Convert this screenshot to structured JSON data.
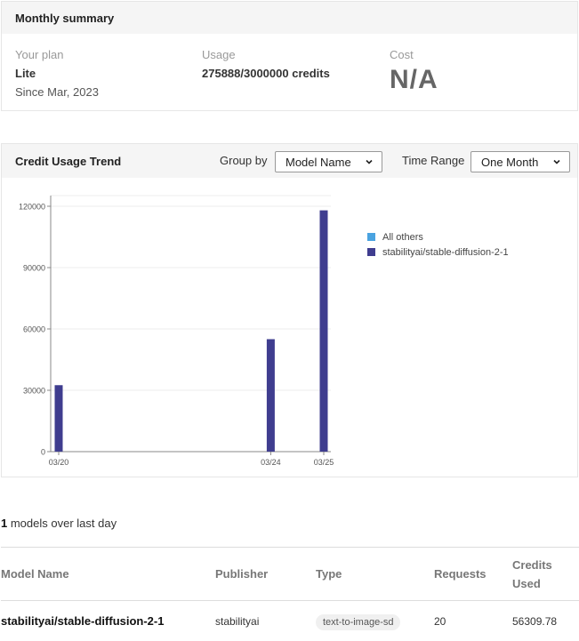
{
  "summary": {
    "title": "Monthly summary",
    "plan_label": "Your plan",
    "plan_value": "Lite",
    "plan_since": "Since Mar, 2023",
    "usage_label": "Usage",
    "usage_value": "275888/3000000 credits",
    "cost_label": "Cost",
    "cost_value": "N/A"
  },
  "trend": {
    "title": "Credit Usage Trend",
    "group_by_label": "Group by",
    "group_by_value": "Model Name",
    "time_range_label": "Time Range",
    "time_range_value": "One Month"
  },
  "colors": {
    "others": "#4aa3e0",
    "stable": "#3f3d8f",
    "axis": "#888888",
    "grid": "#eeeeee"
  },
  "chart_data": {
    "type": "bar",
    "categories": [
      "03/20",
      "03/24",
      "03/25"
    ],
    "category_positions": [
      0,
      4,
      5
    ],
    "x_domain": [
      0,
      5
    ],
    "series": [
      {
        "name": "All others",
        "values": [
          0,
          0,
          0
        ]
      },
      {
        "name": "stabilityai/stable-diffusion-2-1",
        "values": [
          32500,
          55000,
          118000
        ]
      }
    ],
    "yticks": [
      0,
      30000,
      60000,
      90000,
      120000
    ],
    "ylim": [
      0,
      120000
    ],
    "grid": true,
    "legend": "right"
  },
  "models": {
    "count": "1",
    "count_suffix": " models over last day",
    "columns": [
      "Model Name",
      "Publisher",
      "Type",
      "Requests",
      "Credits Used"
    ],
    "rows": [
      {
        "model": "stabilityai/stable-diffusion-2-1",
        "publisher": "stabilityai",
        "type": "text-to-image-sd",
        "requests": "20",
        "credits": "56309.78"
      }
    ]
  }
}
